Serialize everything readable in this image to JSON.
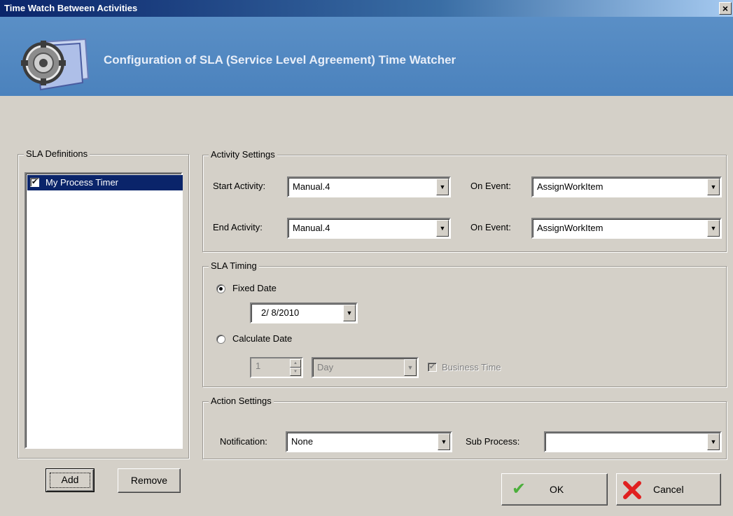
{
  "window": {
    "title": "Time Watch Between Activities",
    "close_glyph": "×"
  },
  "banner": {
    "title": "Configuration of SLA (Service Level Agreement) Time Watcher",
    "icon": "gear-document-icon"
  },
  "sla_definitions": {
    "label": "SLA Definitions",
    "items": [
      {
        "label": "My Process Timer",
        "checked": true,
        "selected": true
      }
    ],
    "add_label": "Add",
    "remove_label": "Remove"
  },
  "activity_settings": {
    "label": "Activity Settings",
    "start_activity_label": "Start Activity:",
    "start_activity_value": "Manual.4",
    "start_on_event_label": "On Event:",
    "start_on_event_value": "AssignWorkItem",
    "end_activity_label": "End Activity:",
    "end_activity_value": "Manual.4",
    "end_on_event_label": "On Event:",
    "end_on_event_value": "AssignWorkItem"
  },
  "sla_timing": {
    "label": "SLA Timing",
    "fixed_date_label": "Fixed Date",
    "fixed_date_value": "2/ 8/2010",
    "calculate_date_label": "Calculate Date",
    "amount_value": "1",
    "unit_value": "Day",
    "business_time_label": "Business Time",
    "selected": "fixed"
  },
  "action_settings": {
    "label": "Action Settings",
    "notification_label": "Notification:",
    "notification_value": "None",
    "sub_process_label": "Sub Process:",
    "sub_process_value": ""
  },
  "footer": {
    "ok_label": "OK",
    "cancel_label": "Cancel"
  },
  "glyphs": {
    "check": "✔",
    "arrow_down": "▼",
    "arrow_up": "▲"
  },
  "colors": {
    "selection": "#0a246a",
    "banner": "#4b82bd",
    "ok_check": "#4caf3c",
    "cancel_x": "#e02020"
  }
}
